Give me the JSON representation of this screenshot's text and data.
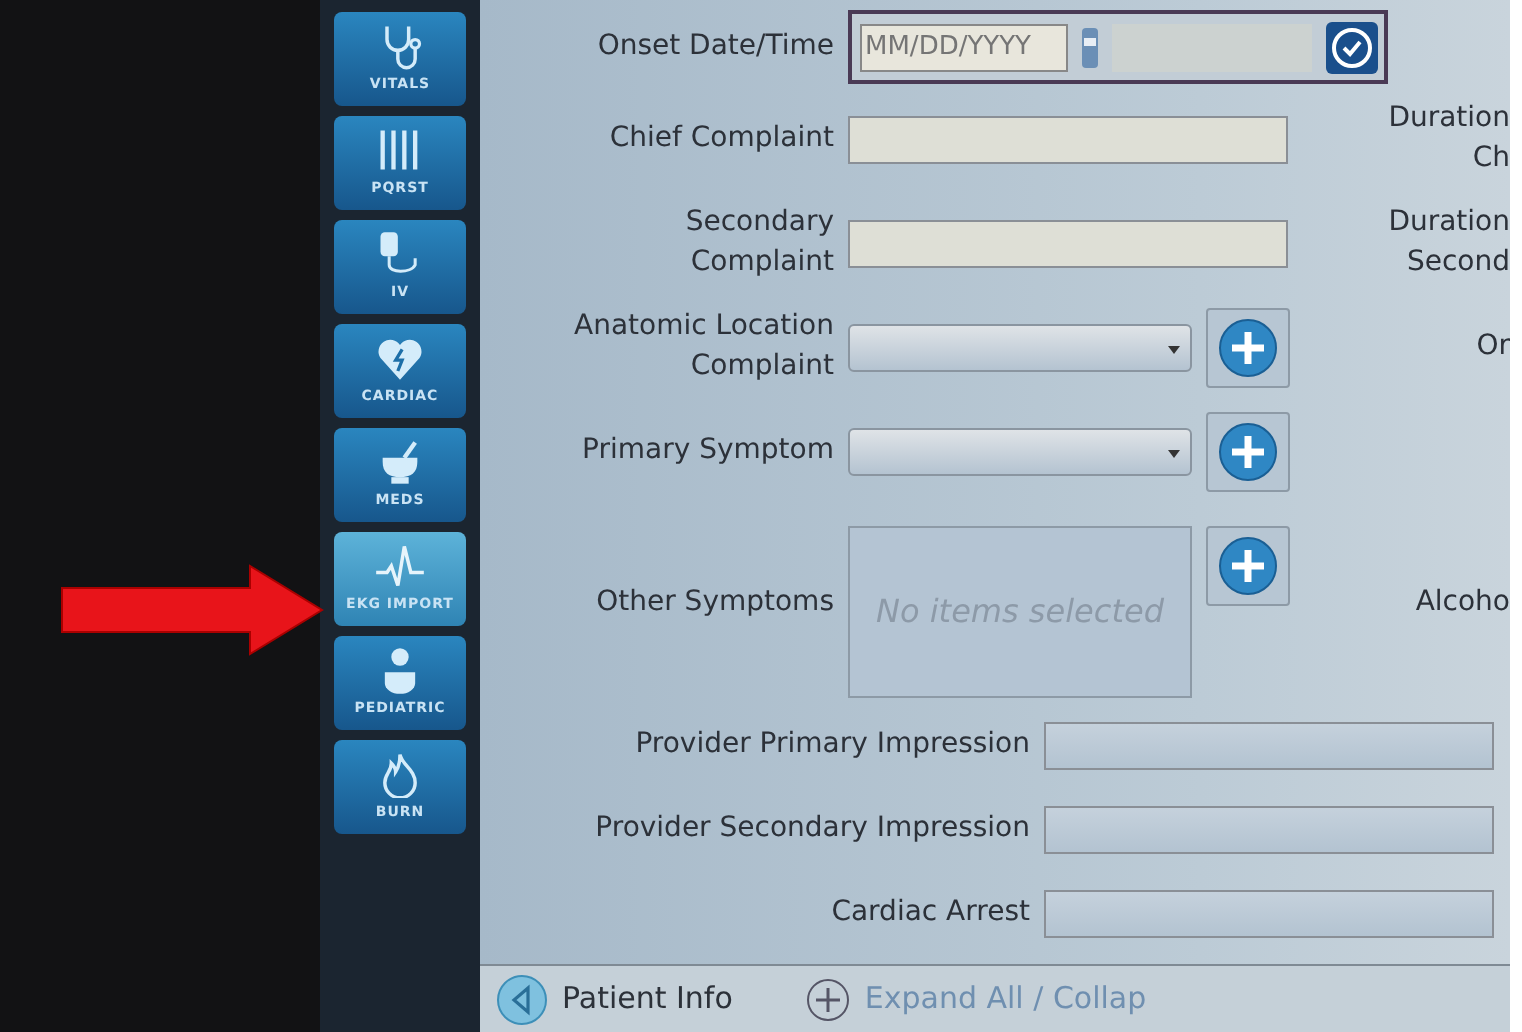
{
  "sidebar": {
    "items": [
      {
        "label": "VITALS",
        "selected": false
      },
      {
        "label": "PQRST",
        "selected": false
      },
      {
        "label": "IV",
        "selected": false
      },
      {
        "label": "CARDIAC",
        "selected": false
      },
      {
        "label": "MEDS",
        "selected": false
      },
      {
        "label": "EKG IMPORT",
        "selected": true
      },
      {
        "label": "PEDIATRIC",
        "selected": false
      },
      {
        "label": "BURN",
        "selected": false
      }
    ]
  },
  "form": {
    "rows": [
      {
        "kind": "datetime",
        "label": "Onset Date/Time",
        "placeholder": "MM/DD/YYYY",
        "right_label": []
      },
      {
        "kind": "text",
        "label": "Chief Complaint",
        "right_label": [
          "Duration",
          "Ch"
        ]
      },
      {
        "kind": "text",
        "label": "Secondary Complaint",
        "right_label": [
          "Duration",
          "Second"
        ]
      },
      {
        "kind": "select",
        "label": "Anatomic Location Complaint",
        "right_label": [
          "Or"
        ]
      },
      {
        "kind": "select",
        "label": "Primary Symptom",
        "right_label": []
      },
      {
        "kind": "list",
        "label": "Other Symptoms",
        "placeholder": "No items selected",
        "right_label": [
          "Alcoho"
        ]
      },
      {
        "kind": "wide",
        "label": "Provider Primary Impression",
        "right_label": []
      },
      {
        "kind": "wide",
        "label": "Provider Secondary Impression",
        "right_label": []
      },
      {
        "kind": "wide",
        "label": "Cardiac Arrest",
        "right_label": []
      }
    ]
  },
  "bottom_bar": {
    "back_label": "Patient Info",
    "expand_label": "Expand All / Collap"
  },
  "annotation": {
    "arrow": true
  }
}
